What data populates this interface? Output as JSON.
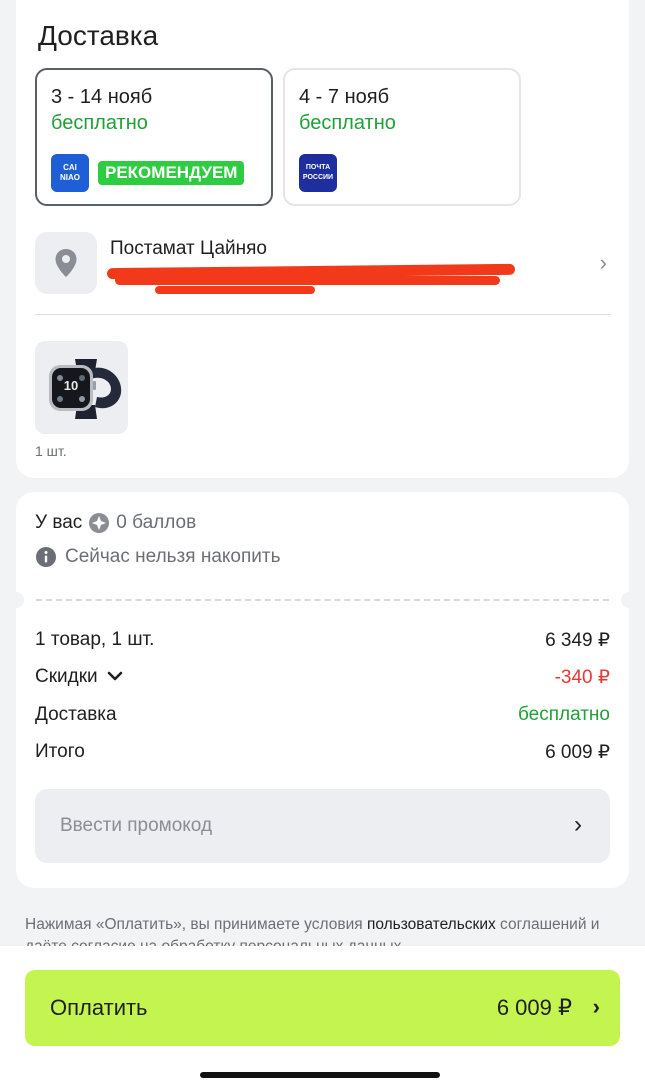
{
  "delivery": {
    "title": "Доставка",
    "options": [
      {
        "dates": "3 - 14 нояб",
        "price": "бесплатно",
        "carrier_logo_text": "CAI\nNIAO",
        "badge": "РЕКОМЕНДУЕМ",
        "selected": true
      },
      {
        "dates": "4 - 7 нояб",
        "price": "бесплатно",
        "carrier_logo_text": "ПОЧТА\nРОССИИ",
        "selected": false
      }
    ],
    "pickup": {
      "name": "Постамат Цайняо",
      "icon": "location-pin-icon"
    },
    "product": {
      "image": "smartwatch-image",
      "quantity": "1 шт."
    }
  },
  "bonus": {
    "label": "У вас",
    "points": "0 баллов",
    "notice": "Сейчас нельзя накопить"
  },
  "summary": {
    "rows": [
      {
        "label": "1 товар, 1 шт.",
        "value": "6 349 ₽"
      },
      {
        "label": "Скидки",
        "value": "-340 ₽"
      },
      {
        "label": "Доставка",
        "value": "бесплатно"
      },
      {
        "label": "Итого",
        "value": "6 009 ₽"
      }
    ],
    "promo_placeholder": "Ввести промокод"
  },
  "terms": {
    "text": "Нажимая «Оплатить», вы принимаете условия ",
    "link": "пользовательских",
    "text2": " соглашений и даёте согласие на обработку персональных данных"
  },
  "pay": {
    "label": "Оплатить",
    "total": "6 009 ₽"
  },
  "colors": {
    "accent_green": "#21a038",
    "discount_red": "#e53935",
    "pay_button": "#c3f44f",
    "badge_green": "#2ecc40"
  }
}
